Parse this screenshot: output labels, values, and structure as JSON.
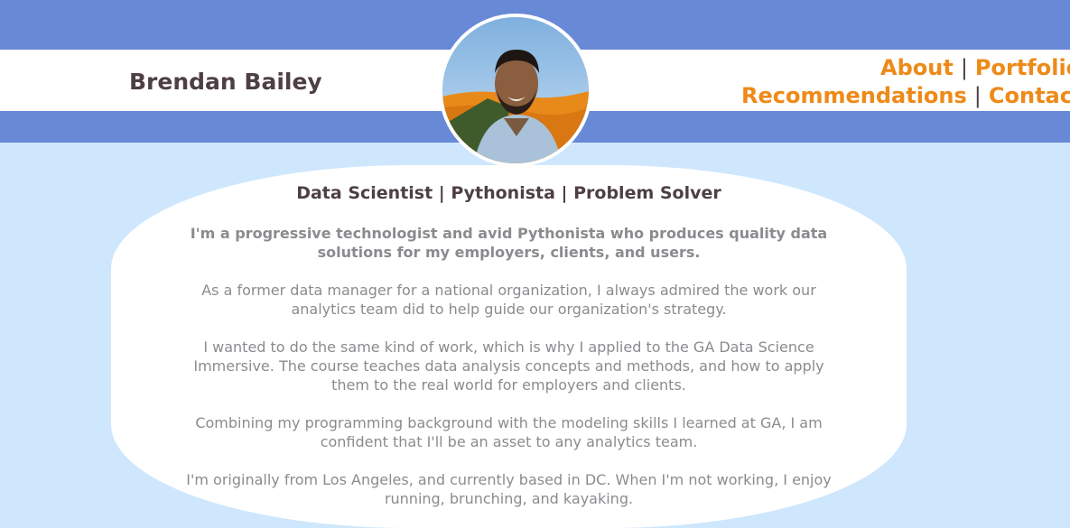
{
  "header": {
    "site_name": "Brendan Bailey",
    "nav": {
      "about": "About",
      "portfolio": "Portfolio",
      "recommendations": "Recommendations",
      "contact": "Contact",
      "separator": "|"
    },
    "profile_photo": "profile-photo"
  },
  "main": {
    "tagline": "Data Scientist | Pythonista | Problem Solver",
    "paragraphs": [
      "I'm a progressive technologist and avid Pythonista who produces quality data solutions for my employers, clients, and users.",
      "As a former data manager for a national organization, I always admired the work our analytics team did to help guide our organization's strategy.",
      "I wanted to do the same kind of work, which is why I applied to the GA Data Science Immersive. The course teaches data analysis concepts and methods, and how to apply them to the real world for employers and clients.",
      "Combining my programming background with the modeling skills I learned at GA, I am confident that I'll be an asset to any analytics team.",
      "I'm originally from Los Angeles, and currently based in DC. When I'm not working, I enjoy running, brunching, and kayaking."
    ]
  },
  "colors": {
    "header_blue": "#6889d6",
    "page_background": "#cfe7fd",
    "nav_orange": "#ee8a18",
    "heading_text": "#4d3f45",
    "body_text": "#8d8a8f"
  }
}
